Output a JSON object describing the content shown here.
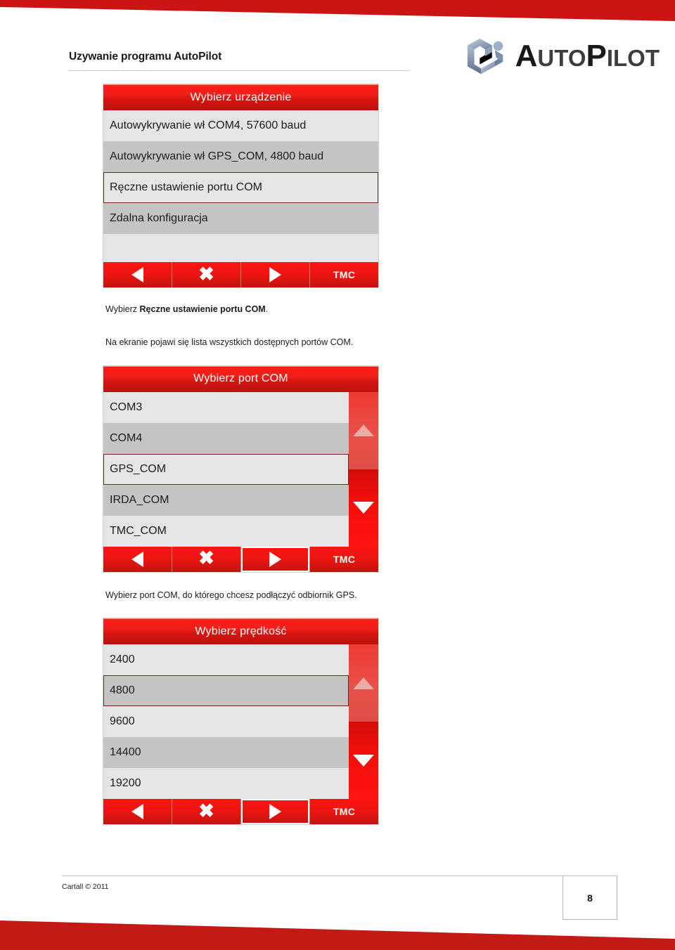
{
  "header": {
    "title": "Uzywanie programu AutoPilot",
    "logo_text_auto": "A",
    "logo_text_uto": "UTO",
    "logo_text_p": "P",
    "logo_text_ilot": "ILOT"
  },
  "dialogs": [
    {
      "name": "select-device",
      "title": "Wybierz urządzenie",
      "rows": [
        {
          "label": "Autowykrywanie wł COM4, 57600 baud",
          "alt": false,
          "selected": false
        },
        {
          "label": "Autowykrywanie wł GPS_COM, 4800 baud",
          "alt": true,
          "selected": false
        },
        {
          "label": "Ręczne ustawienie portu COM",
          "alt": false,
          "selected": true
        },
        {
          "label": "Zdalna konfiguracja",
          "alt": true,
          "selected": false
        },
        {
          "label": "",
          "alt": false,
          "selected": false
        }
      ],
      "has_scrollbar": false,
      "toolbar": {
        "back_label": "back-arrow",
        "close_label": "✖",
        "forward_label": "forward-arrow",
        "tmc_label": "TMC",
        "forward_highlighted": false
      }
    },
    {
      "name": "select-com-port",
      "title": "Wybierz port COM",
      "rows": [
        {
          "label": "COM3",
          "alt": false,
          "selected": false
        },
        {
          "label": "COM4",
          "alt": true,
          "selected": false
        },
        {
          "label": "GPS_COM",
          "alt": false,
          "selected": true
        },
        {
          "label": "IRDA_COM",
          "alt": true,
          "selected": false
        },
        {
          "label": "TMC_COM",
          "alt": false,
          "selected": false
        }
      ],
      "has_scrollbar": true,
      "toolbar": {
        "back_label": "back-arrow",
        "close_label": "✖",
        "forward_label": "forward-arrow",
        "tmc_label": "TMC",
        "forward_highlighted": true
      }
    },
    {
      "name": "select-speed",
      "title": "Wybierz prędkość",
      "rows": [
        {
          "label": "2400",
          "alt": false,
          "selected": false
        },
        {
          "label": "4800",
          "alt": true,
          "selected": true
        },
        {
          "label": "9600",
          "alt": false,
          "selected": false
        },
        {
          "label": "14400",
          "alt": true,
          "selected": false
        },
        {
          "label": "19200",
          "alt": false,
          "selected": false
        }
      ],
      "has_scrollbar": true,
      "toolbar": {
        "back_label": "back-arrow",
        "close_label": "✖",
        "forward_label": "forward-arrow",
        "tmc_label": "TMC",
        "forward_highlighted": true
      }
    }
  ],
  "paragraphs": {
    "p1_lead": "Wybierz ",
    "p1_bold": "Ręczne ustawienie portu COM",
    "p1_tail": ".",
    "p2": "Na ekranie pojawi się lista wszystkich dostępnych portów COM.",
    "p3": "Wybierz port COM, do którego chcesz podłączyć odbiornik GPS."
  },
  "footer": {
    "copyright": "Cartall © 2011",
    "page_number": "8"
  },
  "colors": {
    "accent_red": "#cc1414",
    "title_red_light": "#ff1d14",
    "title_red_dark": "#b9130f",
    "row_light": "#e5e5e5",
    "row_dark": "#c4c4c4",
    "selection_border": "#7d2020",
    "logo_blue": "#7f93b0"
  }
}
